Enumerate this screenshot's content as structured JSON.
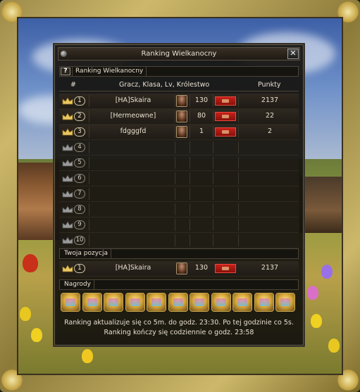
{
  "window": {
    "title": "Ranking Wielkanocny",
    "close_label": "✕",
    "help_label": "?",
    "tab_label": "Ranking Wielkanocny"
  },
  "columns": {
    "rank": "#",
    "player": "Gracz, Klasa, Lv, Królestwo",
    "points": "Punkty"
  },
  "ranking": [
    {
      "rank": "1",
      "name": "[HA]Skaira",
      "level": "130",
      "points": "2137",
      "filled": true
    },
    {
      "rank": "2",
      "name": "[Hermeowne]",
      "level": "80",
      "points": "22",
      "filled": true
    },
    {
      "rank": "3",
      "name": "fdgggfd",
      "level": "1",
      "points": "2",
      "filled": true
    },
    {
      "rank": "4",
      "name": "",
      "level": "",
      "points": "",
      "filled": false
    },
    {
      "rank": "5",
      "name": "",
      "level": "",
      "points": "",
      "filled": false
    },
    {
      "rank": "6",
      "name": "",
      "level": "",
      "points": "",
      "filled": false
    },
    {
      "rank": "7",
      "name": "",
      "level": "",
      "points": "",
      "filled": false
    },
    {
      "rank": "8",
      "name": "",
      "level": "",
      "points": "",
      "filled": false
    },
    {
      "rank": "9",
      "name": "",
      "level": "",
      "points": "",
      "filled": false
    },
    {
      "rank": "10",
      "name": "",
      "level": "",
      "points": "",
      "filled": false
    }
  ],
  "my_position": {
    "section_label": "Twoja pozycja",
    "rank": "1",
    "name": "[HA]Skaira",
    "level": "130",
    "points": "2137"
  },
  "rewards": {
    "section_label": "Nagrody",
    "count": 11
  },
  "footer": {
    "line1": "Ranking aktualizuje się co 5m. do godz. 23:30. Po tej godzinie co 5s.",
    "line2": "Ranking kończy się codziennie o godz. 23:58"
  },
  "colors": {
    "gold_crown": "#e8c860",
    "grey_crown": "#9a9a9a",
    "kingdom_flag": "#c8201a"
  }
}
